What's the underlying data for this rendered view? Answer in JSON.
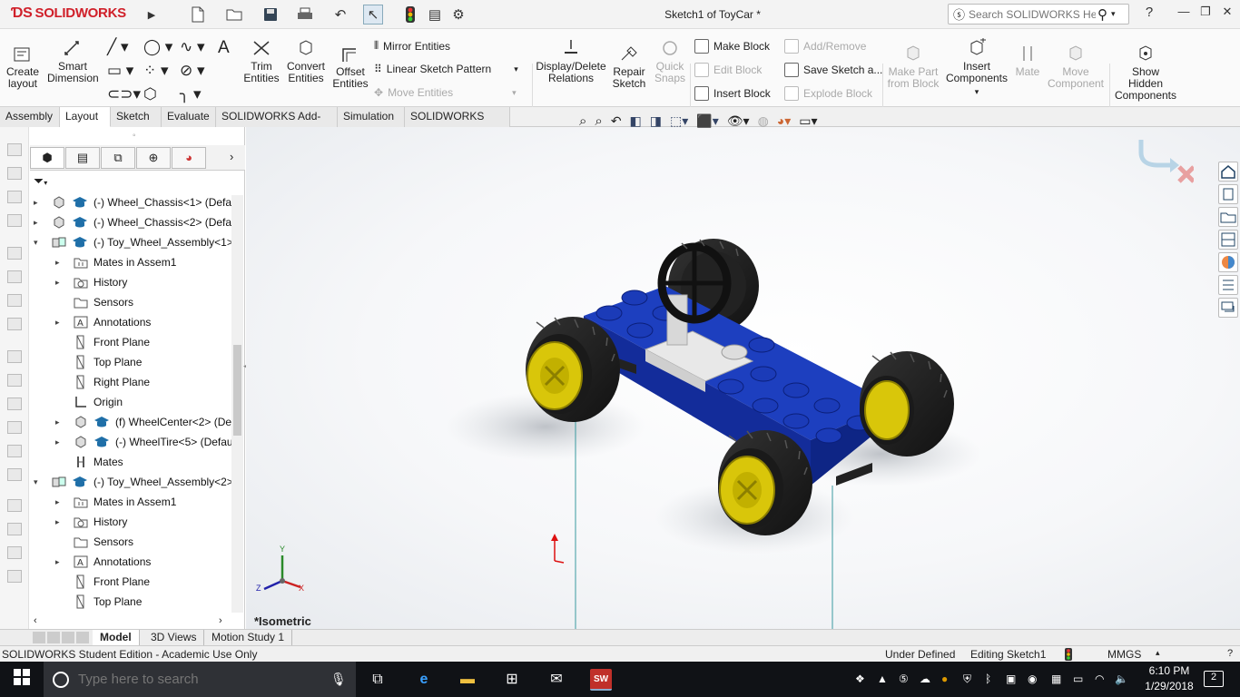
{
  "app": {
    "logo_text": "SOLIDWORKS",
    "document_title": "Sketch1 of ToyCar *",
    "search_placeholder": "Search SOLIDWORKS Help",
    "help_label": "?",
    "window_controls": [
      "minimize-icon",
      "restore-icon",
      "close-icon"
    ]
  },
  "ribbon": {
    "large_buttons": [
      {
        "id": "create-layout",
        "label": "Create\nlayout",
        "enabled": true
      },
      {
        "id": "smart-dimension",
        "label": "Smart\nDimension",
        "enabled": true
      },
      {
        "id": "trim-entities",
        "label": "Trim\nEntities",
        "enabled": true
      },
      {
        "id": "convert-entities",
        "label": "Convert\nEntities",
        "enabled": true
      },
      {
        "id": "offset-entities",
        "label": "Offset\nEntities",
        "enabled": true
      },
      {
        "id": "display-delete-relations",
        "label": "Display/Delete\nRelations",
        "enabled": true
      },
      {
        "id": "repair-sketch",
        "label": "Repair\nSketch",
        "enabled": true
      },
      {
        "id": "quick-snaps",
        "label": "Quick\nSnaps",
        "enabled": false
      },
      {
        "id": "make-part-from-block",
        "label": "Make Part\nfrom Block",
        "enabled": false
      },
      {
        "id": "insert-components",
        "label": "Insert\nComponents",
        "enabled": true
      },
      {
        "id": "mate",
        "label": "Mate",
        "enabled": false
      },
      {
        "id": "move-component",
        "label": "Move\nComponent",
        "enabled": false
      },
      {
        "id": "show-hidden-components",
        "label": "Show\nHidden\nComponents",
        "enabled": true
      }
    ],
    "small_buttons": {
      "mirror_entities": "Mirror Entities",
      "linear_sketch_pattern": "Linear Sketch Pattern",
      "move_entities": "Move Entities",
      "make_block": "Make Block",
      "edit_block": "Edit Block",
      "insert_block": "Insert Block",
      "add_remove": "Add/Remove",
      "save_sketch": "Save Sketch a...",
      "explode_block": "Explode Block"
    }
  },
  "tabs": [
    "Assembly",
    "Layout",
    "Sketch",
    "Evaluate",
    "SOLIDWORKS Add-Ins",
    "Simulation",
    "SOLIDWORKS MBD"
  ],
  "active_tab": "Layout",
  "feature_tree": [
    {
      "level": 0,
      "expander": "▸",
      "icon": "part-icon",
      "label": "(-) Wheel_Chassis<1> (Defau"
    },
    {
      "level": 0,
      "expander": "▸",
      "icon": "part-icon",
      "label": "(-) Wheel_Chassis<2> (Defau"
    },
    {
      "level": 0,
      "expander": "▾",
      "icon": "assembly-icon",
      "label": "(-) Toy_Wheel_Assembly<1>"
    },
    {
      "level": 1,
      "expander": "▸",
      "icon": "mates-folder-icon",
      "label": "Mates in Assem1"
    },
    {
      "level": 1,
      "expander": "▸",
      "icon": "history-icon",
      "label": "History"
    },
    {
      "level": 1,
      "expander": "",
      "icon": "sensors-icon",
      "label": "Sensors"
    },
    {
      "level": 1,
      "expander": "▸",
      "icon": "annotations-icon",
      "label": "Annotations"
    },
    {
      "level": 1,
      "expander": "",
      "icon": "plane-icon",
      "label": "Front Plane"
    },
    {
      "level": 1,
      "expander": "",
      "icon": "plane-icon",
      "label": "Top Plane"
    },
    {
      "level": 1,
      "expander": "",
      "icon": "plane-icon",
      "label": "Right Plane"
    },
    {
      "level": 1,
      "expander": "",
      "icon": "origin-icon",
      "label": "Origin"
    },
    {
      "level": 1,
      "expander": "▸",
      "icon": "part-icon",
      "label": "(f) WheelCenter<2> (De"
    },
    {
      "level": 1,
      "expander": "▸",
      "icon": "part-icon",
      "label": "(-) WheelTire<5> (Defau"
    },
    {
      "level": 1,
      "expander": "",
      "icon": "mates-icon",
      "label": "Mates"
    },
    {
      "level": 0,
      "expander": "▾",
      "icon": "assembly-icon",
      "label": "(-) Toy_Wheel_Assembly<2>"
    },
    {
      "level": 1,
      "expander": "▸",
      "icon": "mates-folder-icon",
      "label": "Mates in Assem1"
    },
    {
      "level": 1,
      "expander": "▸",
      "icon": "history-icon",
      "label": "History"
    },
    {
      "level": 1,
      "expander": "",
      "icon": "sensors-icon",
      "label": "Sensors"
    },
    {
      "level": 1,
      "expander": "▸",
      "icon": "annotations-icon",
      "label": "Annotations"
    },
    {
      "level": 1,
      "expander": "",
      "icon": "plane-icon",
      "label": "Front Plane"
    },
    {
      "level": 1,
      "expander": "",
      "icon": "plane-icon",
      "label": "Top Plane"
    }
  ],
  "viewport": {
    "view_label": "*Isometric",
    "triad": {
      "x": "X",
      "y": "Y",
      "z": "Z"
    }
  },
  "bottom_tabs": [
    "Model",
    "3D Views",
    "Motion Study 1"
  ],
  "active_bottom_tab": "Model",
  "status": {
    "edition": "SOLIDWORKS Student Edition - Academic Use Only",
    "sketch_state": "Under Defined",
    "editing": "Editing Sketch1",
    "units": "MMGS"
  },
  "taskbar": {
    "search_placeholder": "Type here to search",
    "time": "6:10 PM",
    "date": "1/29/2018",
    "notification_count": "2",
    "app_icons": [
      "task-view-icon",
      "edge-icon",
      "file-explorer-icon",
      "store-icon",
      "mail-icon",
      "solidworks-icon"
    ]
  },
  "colors": {
    "brand_red": "#d0202a",
    "chassis_blue": "#1d3fbf",
    "wheel_yellow": "#d9c60a",
    "taskbar": "#101216"
  }
}
